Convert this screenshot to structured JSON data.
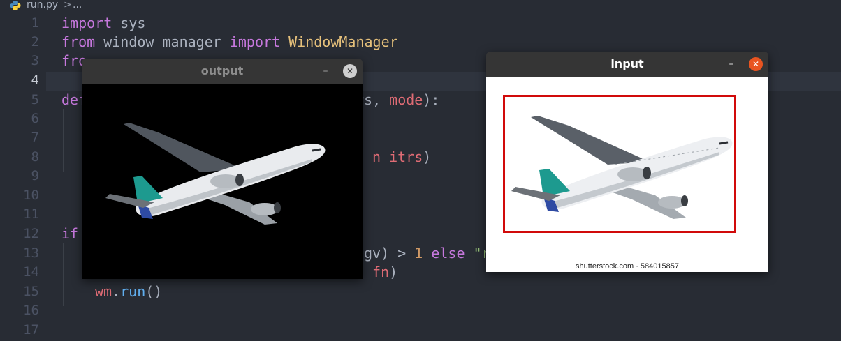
{
  "editor": {
    "breadcrumb": {
      "file": "run.py",
      "separator": ">",
      "more": "..."
    },
    "active_line": "4",
    "line_numbers": [
      "1",
      "2",
      "3",
      "4",
      "5",
      "6",
      "7",
      "8",
      "9",
      "10",
      "11",
      "12",
      "13",
      "14",
      "15",
      "16",
      "17"
    ],
    "code": {
      "l1": {
        "kw": "import",
        "rest": " sys"
      },
      "l2": {
        "kw1": "from",
        "mod": " window_manager ",
        "kw2": "import",
        "cls": " WindowManager"
      },
      "l3": {
        "kw": "fro"
      },
      "l5_left": {
        "kw": "def"
      },
      "l5_right": {
        "a": "rs, ",
        "b": "mode",
        "c": "):"
      },
      "l8_right": {
        "a": "n_itrs",
        "b": ")"
      },
      "l12_left": {
        "kw": "if"
      },
      "l13_right": {
        "a": "gv) > ",
        "num": "1",
        "kw": " else ",
        "str": "\"r"
      },
      "l14_right": {
        "a": "_fn",
        "b": ")"
      },
      "l15": {
        "obj": "wm",
        "dot": ".",
        "fn": "run",
        "paren": "()"
      }
    },
    "colors": {
      "background": "#282c34",
      "keyword": "#c678dd",
      "class": "#e5c07b",
      "variable": "#e06c75",
      "number": "#d19a66",
      "function": "#61afef",
      "string": "#98c379"
    }
  },
  "output_window": {
    "title": "output",
    "minimize_label": "–",
    "close_label": "✕",
    "image_icon": "airplane-silhouette"
  },
  "input_window": {
    "title": "input",
    "minimize_label": "–",
    "close_label": "✕",
    "image_icon": "airplane-photo",
    "watermark": "shutterstock.com · 584015857",
    "roi_color": "#d10a0a"
  }
}
